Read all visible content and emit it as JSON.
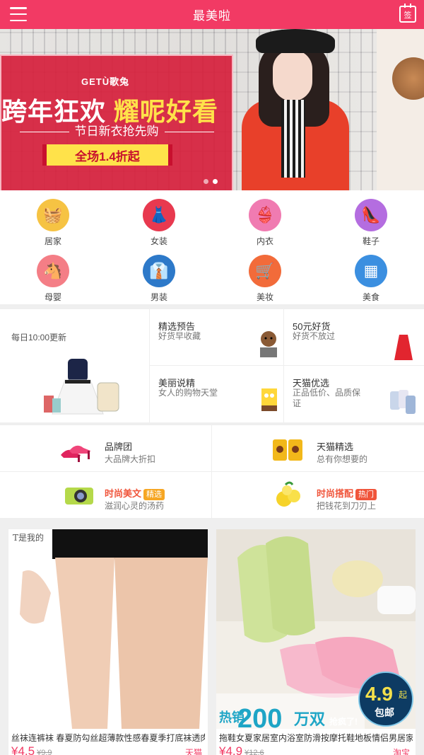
{
  "header": {
    "title": "最美啦",
    "checkin_label": "签"
  },
  "banner": {
    "brand": "GETÙ歌兔",
    "slogan_white": "跨年狂欢 ",
    "slogan_yellow": "耀呢好看",
    "subtitle": "节日新衣抢先购",
    "deal": "全场1.4折起",
    "slides": 2,
    "active_slide": 2
  },
  "categories": [
    {
      "label": "居家",
      "color": "#f6c343",
      "icon": "basket-icon",
      "glyph": "🧺"
    },
    {
      "label": "女装",
      "color": "#e8394f",
      "icon": "dress-icon",
      "glyph": "👗"
    },
    {
      "label": "内衣",
      "color": "#f07bb1",
      "icon": "bra-icon",
      "glyph": "👙"
    },
    {
      "label": "鞋子",
      "color": "#b46de0",
      "icon": "high-heel-icon",
      "glyph": "👠"
    },
    {
      "label": "母婴",
      "color": "#f47e86",
      "icon": "rocking-horse-icon",
      "glyph": "🐴"
    },
    {
      "label": "男装",
      "color": "#2d79c9",
      "icon": "suit-icon",
      "glyph": "👔"
    },
    {
      "label": "美妆",
      "color": "#f26b3a",
      "icon": "stroller-icon",
      "glyph": "🛒"
    },
    {
      "label": "美食",
      "color": "#3b8fe0",
      "icon": "grid-icon",
      "glyph": "▦"
    }
  ],
  "promo": {
    "big_time": "每日10:00更新",
    "cells": [
      {
        "title": "精选预告",
        "subtitle": "好货早收藏"
      },
      {
        "title": "50元好货",
        "subtitle": "好货不放过"
      },
      {
        "title": "美丽说精",
        "subtitle": "女人的购物天堂"
      },
      {
        "title": "天猫优选",
        "subtitle": "正品低价、品质保证"
      }
    ]
  },
  "brands": [
    {
      "title": "品牌团",
      "subtitle": "大品牌大折扣",
      "tag": ""
    },
    {
      "title": "天猫精选",
      "subtitle": "总有你想要的",
      "tag": ""
    },
    {
      "title": "时尚美文",
      "subtitle": "滋润心灵的汤药",
      "tag": "精选",
      "tag_color": "#f6a623"
    },
    {
      "title": "时尚搭配",
      "subtitle": "把钱花到刀刃上",
      "tag": "热门",
      "tag_color": "#f0553b"
    }
  ],
  "products": [
    {
      "name": "丝袜连裤袜 春夏防勾丝超薄款性感春夏季打底袜透肉女",
      "price": "¥4.5",
      "old_price": "¥9.9",
      "shop": "天猫",
      "brand_mark": "T是我的"
    },
    {
      "name": "拖鞋女夏家居室内浴室防滑按摩托鞋地板情侣男居家可",
      "price": "¥4.9",
      "old_price": "¥12.6",
      "shop": "淘宝",
      "promo_hot": "热销",
      "promo_num": "200",
      "promo_unit": "万双",
      "promo_rush": "抢疯了!",
      "badge_price": "4.9",
      "badge_suffix": "起",
      "badge_label": "包邮"
    }
  ]
}
